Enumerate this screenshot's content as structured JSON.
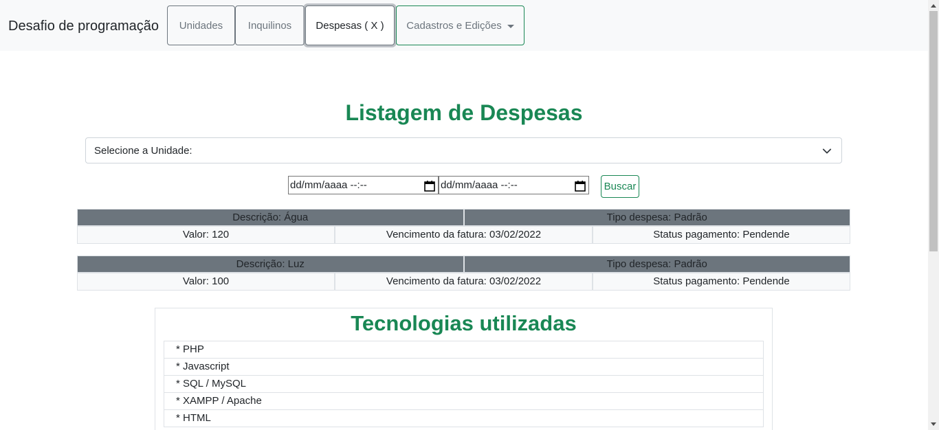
{
  "navbar": {
    "brand": "Desafio de programação",
    "items": [
      {
        "label": "Unidades"
      },
      {
        "label": "Inquilinos"
      },
      {
        "label": "Despesas ( X )"
      },
      {
        "label": "Cadastros e Edições"
      }
    ]
  },
  "main": {
    "title": "Listagem de Despesas",
    "unit_select": {
      "selected": "Selecione a Unidade:"
    },
    "date_start": {
      "placeholder": "dd/mm/aaaa --:--"
    },
    "date_end": {
      "placeholder": "dd/mm/aaaa --:--"
    },
    "search_button": "Buscar",
    "expenses": [
      {
        "descricao": "Descrição: Água",
        "tipo": "Tipo despesa: Padrão",
        "valor": "Valor: 120",
        "vencimento": "Vencimento da fatura: 03/02/2022",
        "status": "Status pagamento: Pendende"
      },
      {
        "descricao": "Descrição: Luz",
        "tipo": "Tipo despesa: Padrão",
        "valor": "Valor: 100",
        "vencimento": "Vencimento da fatura: 03/02/2022",
        "status": "Status pagamento: Pendende"
      }
    ]
  },
  "tech": {
    "title": "Tecnologias utilizadas",
    "items": [
      "* PHP",
      "* Javascript",
      "* SQL / MySQL",
      "* XAMPP / Apache",
      "* HTML"
    ]
  },
  "colors": {
    "accent": "#198754",
    "header_gray": "#6c757d",
    "row_bg": "#f8f9fa"
  },
  "icons": {
    "select": "chevron-down-icon",
    "date": "calendar-icon",
    "dropdown": "caret-down-icon"
  }
}
